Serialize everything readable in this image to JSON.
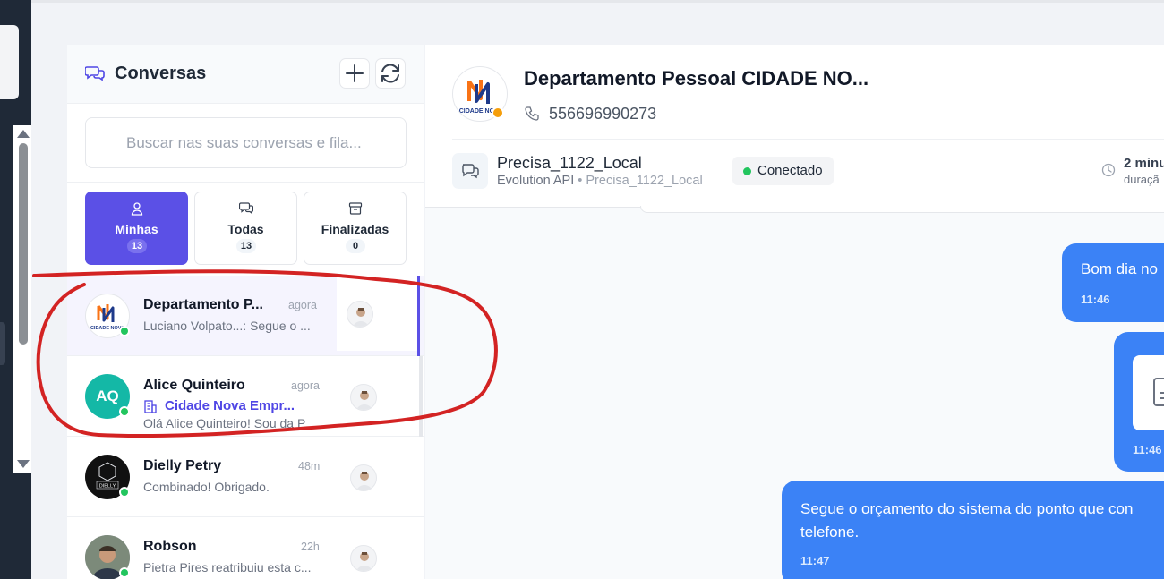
{
  "conversations_panel": {
    "title": "Conversas",
    "search": {
      "placeholder": "Buscar nas suas conversas e fila...",
      "value": ""
    },
    "tabs": [
      {
        "label": "Minhas",
        "count": "13",
        "active": true,
        "icon": "user-icon"
      },
      {
        "label": "Todas",
        "count": "13",
        "active": false,
        "icon": "chat-icon"
      },
      {
        "label": "Finalizadas",
        "count": "0",
        "active": false,
        "icon": "archive-icon"
      }
    ],
    "items": [
      {
        "name": "Departamento P...",
        "time": "agora",
        "preview": "Luciano Volpato...: Segue o ...",
        "avatar": "cidade-nova-logo"
      },
      {
        "name": "Alice Quinteiro",
        "time": "agora",
        "company": "Cidade Nova Empr...",
        "preview": "Olá Alice Quinteiro! Sou da P...",
        "initials": "AQ"
      },
      {
        "name": "Dielly Petry",
        "time": "48m",
        "preview": "Combinado! Obrigado.",
        "avatar": "dielly-logo",
        "avatar_text": "DIELLY"
      },
      {
        "name": "Robson",
        "time": "22h",
        "preview": "Pietra Pires reatribuiu esta c...",
        "avatar": "photo"
      }
    ]
  },
  "chat": {
    "name": "Departamento Pessoal CIDADE NO...",
    "phone": "556696990273",
    "logo_text": "CIDADE NOVA",
    "instance": {
      "name": "Precisa_1122_Local",
      "provider": "Evolution API",
      "separator": "•",
      "instance_sub": "Precisa_1122_Local",
      "status": "Conectado"
    },
    "duration": {
      "value": "2 minu",
      "label": "duraçã"
    },
    "messages": [
      {
        "text": "Bom dia no",
        "time": "11:46"
      },
      {
        "type": "document",
        "time": "11:46"
      },
      {
        "text": "Segue o orçamento do sistema do ponto que con\ntelefone.",
        "time": "11:47"
      }
    ]
  },
  "colors": {
    "accent": "#5b50e6",
    "bubble": "#3b82f6",
    "online": "#22c55e",
    "away": "#f59e0b",
    "annotation": "#d32323",
    "rail": "#1f2937"
  }
}
